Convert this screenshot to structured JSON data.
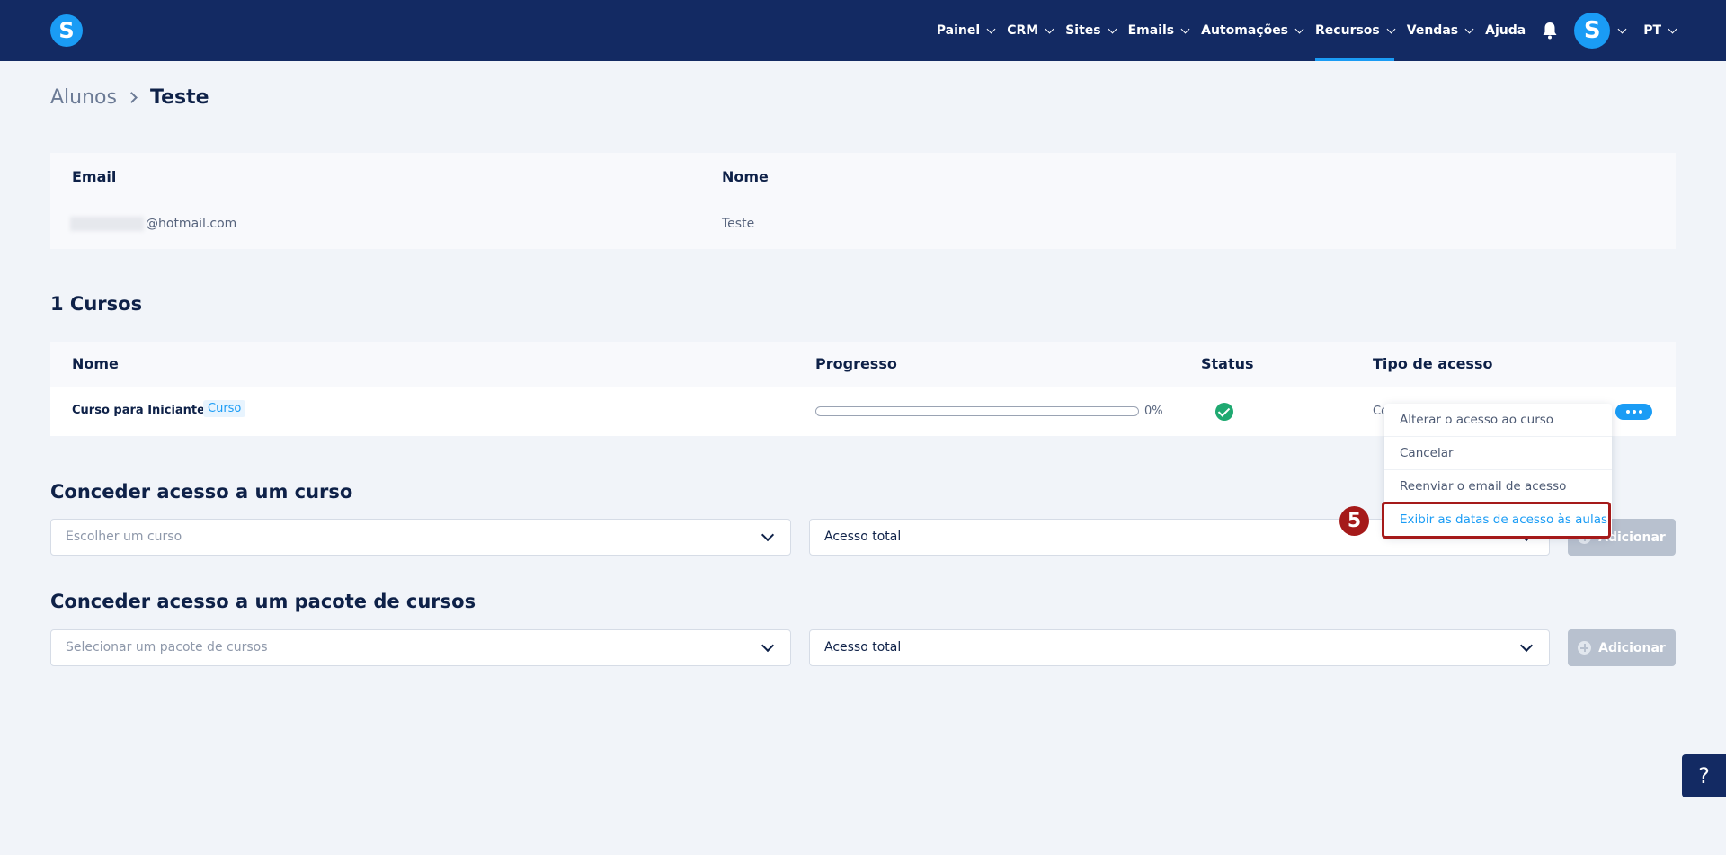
{
  "app": {
    "logo_letter": "S"
  },
  "nav": {
    "items": [
      {
        "label": "Painel",
        "dropdown": true,
        "active": false
      },
      {
        "label": "CRM",
        "dropdown": true,
        "active": false
      },
      {
        "label": "Sites",
        "dropdown": true,
        "active": false
      },
      {
        "label": "Emails",
        "dropdown": true,
        "active": false
      },
      {
        "label": "Automações",
        "dropdown": true,
        "active": false
      },
      {
        "label": "Recursos",
        "dropdown": true,
        "active": true
      },
      {
        "label": "Vendas",
        "dropdown": true,
        "active": false
      },
      {
        "label": "Ajuda",
        "dropdown": false,
        "active": false
      }
    ],
    "avatar_letter": "S",
    "language": "PT"
  },
  "breadcrumb": {
    "parent": "Alunos",
    "current": "Teste"
  },
  "student": {
    "headers": {
      "email": "Email",
      "name": "Nome"
    },
    "email_visible": "@hotmail.com",
    "name": "Teste"
  },
  "courses": {
    "title": "1 Cursos",
    "headers": {
      "name": "Nome",
      "progress": "Progresso",
      "status": "Status",
      "access_type": "Tipo de acesso"
    },
    "rows": [
      {
        "name": "Curso para Iniciantes",
        "tag": "Curso",
        "progress_text": "0%",
        "progress": 0,
        "status": "active",
        "access_type": "Co"
      }
    ]
  },
  "row_menu": {
    "items": [
      "Alterar o acesso ao curso",
      "Cancelar",
      "Reenviar o email de acesso",
      "Exibir as datas de acesso às aulas"
    ],
    "step_number": "5"
  },
  "grant_course": {
    "title": "Conceder acesso a um curso",
    "course_placeholder": "Escolher um curso",
    "access_value": "Acesso total",
    "add_label": "Adicionar"
  },
  "grant_bundle": {
    "title": "Conceder acesso a um pacote de cursos",
    "bundle_placeholder": "Selecionar um pacote de cursos",
    "access_value": "Acesso total",
    "add_label": "Adicionar"
  },
  "help": {
    "label": "?"
  },
  "colors": {
    "nav_bg": "#132a63",
    "accent": "#1a9cf5",
    "success": "#1fa971",
    "callout": "#a51a1a"
  }
}
